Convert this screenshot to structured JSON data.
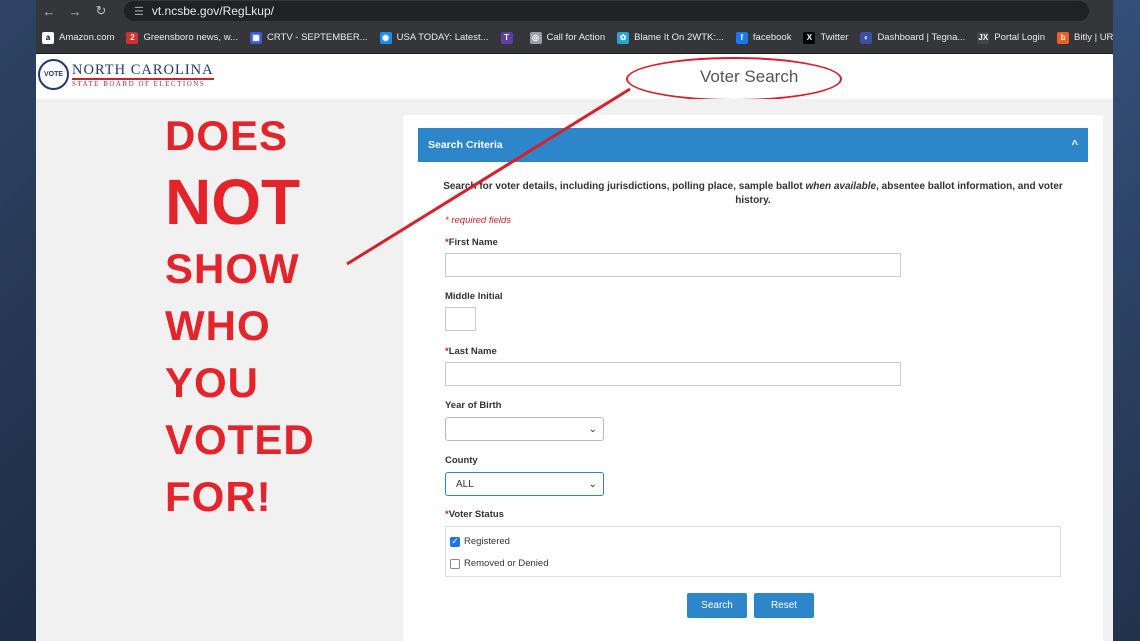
{
  "browser": {
    "url": "vt.ncsbe.gov/RegLkup/",
    "nav": {
      "back": "←",
      "forward": "→",
      "reload": "↻",
      "tune": "☰"
    },
    "bookmarks": [
      {
        "label": "Amazon.com",
        "icon": "a",
        "color": "#ffffff"
      },
      {
        "label": "Greensboro news, w...",
        "icon": "2",
        "color": "#d32f2f"
      },
      {
        "label": "CRTV - SEPTEMBER...",
        "icon": "▦",
        "color": "#3b5bdb"
      },
      {
        "label": "USA TODAY: Latest...",
        "icon": "◉",
        "color": "#1a8cff"
      },
      {
        "label": "",
        "icon": "T",
        "color": "#5b3fa3"
      },
      {
        "label": "Call for Action",
        "icon": "◎",
        "color": "#9aa0a6"
      },
      {
        "label": "Blame It On 2WTK:...",
        "icon": "✿",
        "color": "#26a3d9"
      },
      {
        "label": "facebook",
        "icon": "f",
        "color": "#1877f2"
      },
      {
        "label": "Twitter",
        "icon": "X",
        "color": "#000000"
      },
      {
        "label": "Dashboard | Tegna...",
        "icon": "◐",
        "color": "#3a4fa0"
      },
      {
        "label": "Portal Login",
        "icon": "JX",
        "color": "#444444"
      },
      {
        "label": "Bitly | URL Shortene...",
        "icon": "b",
        "color": "#ee6123"
      },
      {
        "label": "",
        "icon": "SI",
        "color": "#222222"
      }
    ]
  },
  "header": {
    "logo_seal": "VOTE",
    "logo_name": "NORTH CAROLINA",
    "logo_sub": "STATE BOARD OF ELECTIONS",
    "page_title": "Voter Search"
  },
  "callout": {
    "line1": "DOES",
    "line2": "NOT",
    "line3": "SHOW",
    "line4": "WHO",
    "line5": "YOU",
    "line6": "VOTED",
    "line7": "FOR!",
    "color": "#e3242b"
  },
  "form": {
    "section_title": "Search Criteria",
    "collapse_icon": "^",
    "intro_before": "Search for voter details, including jurisdictions, polling place, sample ballot",
    "intro_italic": "when available",
    "intro_after": ", absentee ballot information, and voter history.",
    "required_note": "* required fields",
    "required_mark": "*",
    "first_name_label": "First Name",
    "middle_initial_label": "Middle Initial",
    "last_name_label": "Last Name",
    "year_of_birth_label": "Year of Birth",
    "year_of_birth_value": "",
    "county_label": "County",
    "county_value": "ALL",
    "voter_status_label": "Voter Status",
    "status_options": [
      {
        "label": "Registered",
        "checked": true
      },
      {
        "label": "Removed or Denied",
        "checked": false
      }
    ],
    "check_mark": "✓",
    "dropdown_arrow": "⌄",
    "search_button": "Search",
    "reset_button": "Reset"
  },
  "colors": {
    "accent": "#2d86c9",
    "annotation_red": "#d6202b"
  }
}
